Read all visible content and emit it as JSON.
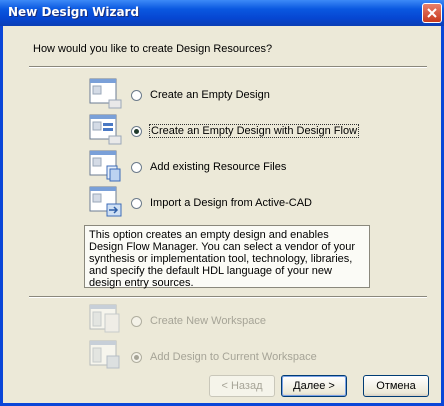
{
  "window": {
    "title": "New Design Wizard"
  },
  "prompt": "How would you like to create Design Resources?",
  "options": [
    {
      "label": "Create an Empty Design",
      "selected": false,
      "icon": "empty-design-icon"
    },
    {
      "label": "Create an Empty Design with Design Flow",
      "selected": true,
      "icon": "design-flow-icon"
    },
    {
      "label": "Add existing Resource Files",
      "selected": false,
      "icon": "resource-files-icon"
    },
    {
      "label": "Import a Design from Active-CAD",
      "selected": false,
      "icon": "import-design-icon"
    }
  ],
  "description": "This option creates an empty design and enables Design Flow Manager. You can select a vendor of your synthesis or implementation tool, technology, libraries, and specify the default HDL language of your new design entry sources.",
  "workspace_options": [
    {
      "label": "Create New Workspace",
      "selected": false,
      "disabled": true,
      "icon": "new-workspace-icon"
    },
    {
      "label": "Add Design to Current Workspace",
      "selected": true,
      "disabled": true,
      "icon": "current-workspace-icon"
    }
  ],
  "buttons": {
    "back": "< Назад",
    "next": "Далее >",
    "cancel": "Отмена"
  },
  "colors": {
    "titlebar": "#0a58e0",
    "dialog_bg": "#ece9d8",
    "accent": "#0a46d8"
  }
}
